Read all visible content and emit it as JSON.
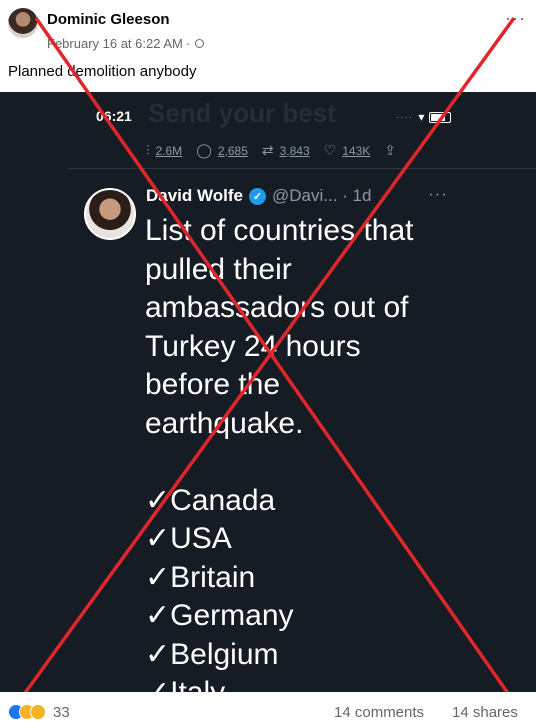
{
  "post": {
    "author": "Dominic Gleeson",
    "timestamp": "February 16 at 6:22 AM",
    "separator": "·",
    "privacy_icon": "globe-icon",
    "more_icon": "···",
    "caption": "Planned demolition anybody"
  },
  "screenshot": {
    "status_time": "06:21",
    "ghost_text": "Send your best",
    "views": "2.6M",
    "replies": "2,685",
    "retweets": "3,843",
    "likes": "143K",
    "tweet": {
      "author_name": "David Wolfe",
      "handle": "@Davi... · 1d",
      "more": "···",
      "lines": [
        "List of countries that",
        "pulled their",
        "ambassadors out of",
        "Turkey 24 hours",
        "before the",
        "earthquake.",
        "",
        "✓Canada",
        "✓USA",
        "✓Britain",
        "✓Germany",
        "✓Belgium",
        "✓Italy"
      ]
    },
    "overlay_color": "#e0262c"
  },
  "footer": {
    "reaction_count": "33",
    "comments": "14 comments",
    "shares": "14 shares"
  }
}
